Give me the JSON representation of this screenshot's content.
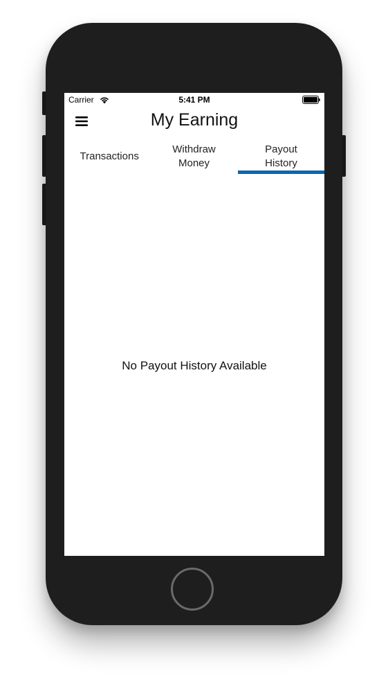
{
  "status_bar": {
    "carrier": "Carrier",
    "time": "5:41 PM",
    "wifi_icon": "wifi-icon",
    "battery_icon": "battery-full-icon"
  },
  "nav": {
    "menu_icon": "hamburger-menu-icon",
    "title": "My Earning"
  },
  "tabs": [
    {
      "label": "Transactions",
      "selected": false
    },
    {
      "label": "Withdraw Money",
      "selected": false
    },
    {
      "label": "Payout History",
      "selected": true
    }
  ],
  "main": {
    "empty_message": "No Payout History Available"
  },
  "colors": {
    "accent": "#0c67ad",
    "device_body": "#1e1e1e",
    "screen_background": "#ffffff"
  }
}
